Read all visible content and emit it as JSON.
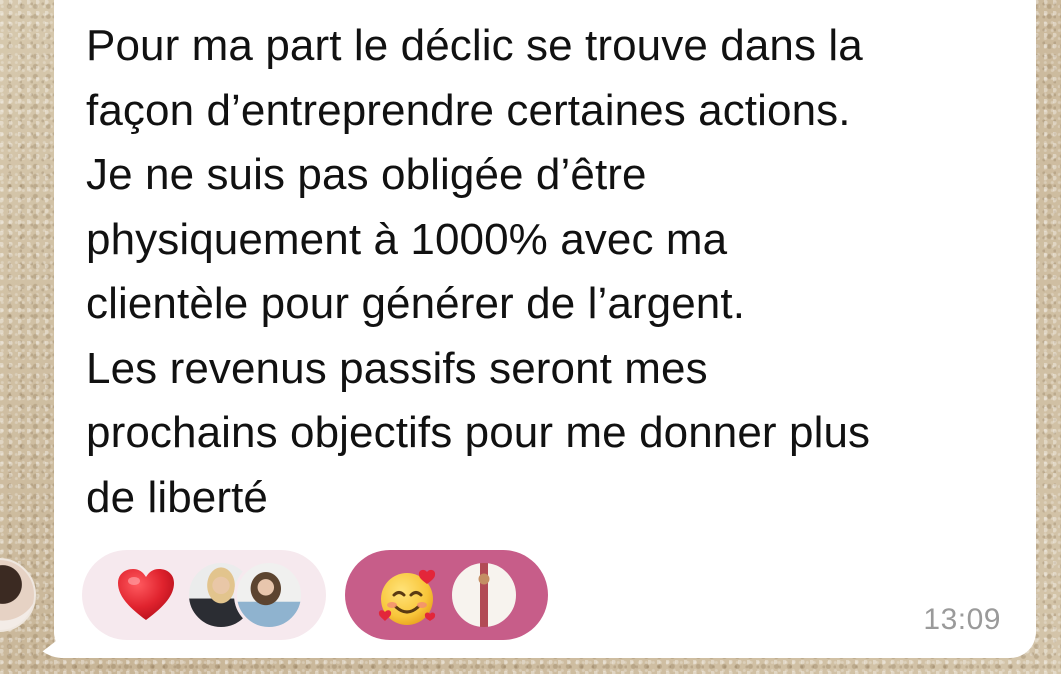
{
  "message": {
    "lines": [
      "Pour ma part le déclic se trouve dans la",
      "façon d’entreprendre certaines actions.",
      "Je ne suis pas obligée d’être",
      "physiquement à 1000% avec ma",
      "clientèle pour générer de l’argent.",
      "Les revenus passifs seront mes",
      "prochains objectifs pour me donner plus",
      "de liberté"
    ],
    "time": "13:09"
  },
  "reactions": [
    {
      "emoji": "red-heart-icon",
      "reactors": 2,
      "selected": false,
      "color": "#f6e9ee"
    },
    {
      "emoji": "smiling-face-with-hearts-icon",
      "reactors": 1,
      "selected": true,
      "color": "#c75d89"
    }
  ],
  "colors": {
    "bubble": "#ffffff",
    "text": "#111111",
    "timestamp": "#9a9a9a",
    "heart": "#e0232e",
    "selected_reaction": "#c75d89"
  }
}
